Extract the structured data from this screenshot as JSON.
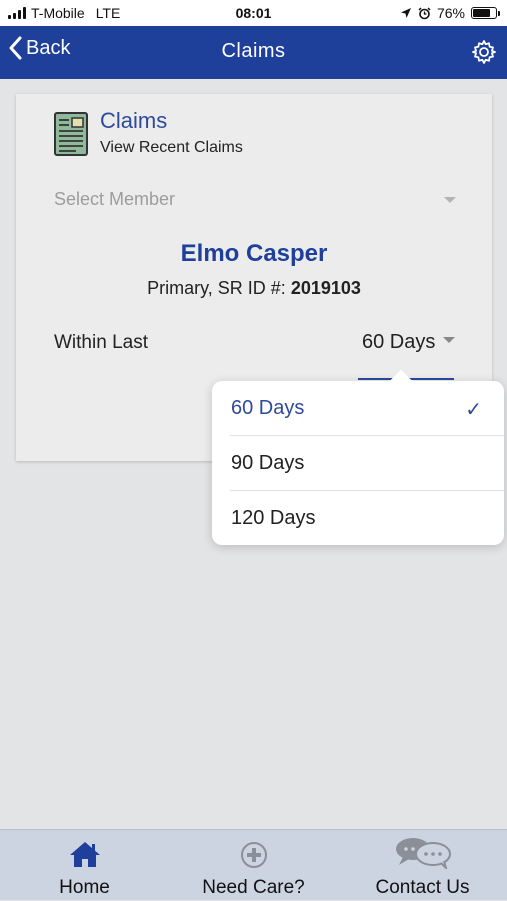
{
  "status_bar": {
    "carrier": "T-Mobile",
    "network": "LTE",
    "time": "08:01",
    "battery_percent": "76%",
    "battery_level": 0.76
  },
  "nav": {
    "back_label": "Back",
    "title": "Claims",
    "icons": {
      "back": "chevron-left-icon",
      "settings": "gear-icon"
    },
    "color": "#1e3f9a"
  },
  "card": {
    "heading": "Claims",
    "subheading": "View Recent Claims",
    "icon": "claims-document-icon",
    "member_select": {
      "placeholder": "Select Member"
    },
    "member": {
      "name": "Elmo Casper",
      "id_label": "Primary, SR ID #:",
      "id_value": "2019103"
    },
    "within_label": "Within Last",
    "days_selected": "60 Days"
  },
  "dropdown": {
    "options": [
      {
        "label": "60 Days",
        "selected": true
      },
      {
        "label": "90 Days",
        "selected": false
      },
      {
        "label": "120 Days",
        "selected": false
      }
    ],
    "check_icon": "checkmark-icon"
  },
  "tabs": [
    {
      "label": "Home",
      "icon": "home-icon"
    },
    {
      "label": "Need Care?",
      "icon": "plus-circle-icon"
    },
    {
      "label": "Contact Us",
      "icon": "chat-bubbles-icon"
    }
  ],
  "colors": {
    "primary": "#1e3f9a",
    "accent": "#2e4a9b",
    "background": "#e3e4e6",
    "tab_bar": "#ccd4e1"
  }
}
